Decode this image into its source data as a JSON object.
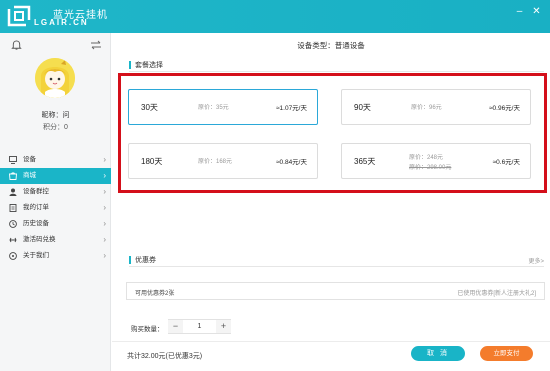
{
  "app": {
    "title": "蓝光云挂机",
    "subtitle": "LGAIR.CN",
    "window_controls": [
      "–",
      "✕"
    ]
  },
  "user": {
    "nickname": "昵称：问",
    "points": "积分：0"
  },
  "menu": [
    {
      "label": "设备",
      "icon": "monitor-icon"
    },
    {
      "label": "商城",
      "icon": "store-icon",
      "active": true
    },
    {
      "label": "设备群控",
      "icon": "group-icon"
    },
    {
      "label": "我的订单",
      "icon": "document-icon"
    },
    {
      "label": "历史设备",
      "icon": "history-icon"
    },
    {
      "label": "激活码兑换",
      "icon": "key-icon"
    },
    {
      "label": "关于我们",
      "icon": "info-icon"
    }
  ],
  "main": {
    "device_type": "设备类型：普通设备",
    "package_section_title": "套餐选择",
    "plans": [
      {
        "days": "30天",
        "original": "原价：35元",
        "per_day": "≈1.07元/天",
        "selected": true
      },
      {
        "days": "90天",
        "original": "原价：96元",
        "per_day": "≈0.96元/天"
      },
      {
        "days": "180天",
        "original": "原价：168元",
        "per_day": "≈0.84元/天"
      },
      {
        "days": "365天",
        "original": "原价：248元",
        "original_struck": "原价：298.00元",
        "per_day": "≈0.6元/天"
      }
    ],
    "coupon_section_title": "优惠券",
    "more_link": "更多>",
    "coupon_available": "可用优惠券2张",
    "coupon_used": "已使用优惠券[新人注册大礼2]",
    "quantity_label": "购买数量：",
    "quantity_value": "1",
    "quantity_minus": "−",
    "quantity_plus": "+",
    "total": "共计32.00元(已优惠3元)",
    "cancel_button": "取 消",
    "pay_button": "立即支付"
  },
  "colors": {
    "accent": "#1ab5c8",
    "highlight_frame": "#d40f1a",
    "pay": "#f47c2c"
  }
}
